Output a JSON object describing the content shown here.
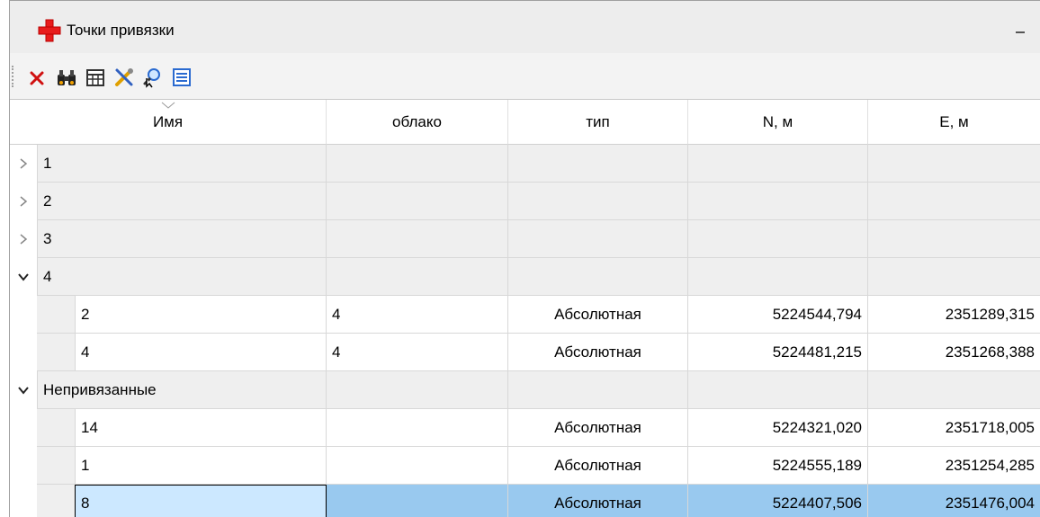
{
  "panel": {
    "title": "Точки привязки"
  },
  "toolbar": {
    "buttons": [
      {
        "name": "delete-icon"
      },
      {
        "name": "binoculars-icon"
      },
      {
        "name": "table-icon"
      },
      {
        "name": "tools-icon"
      },
      {
        "name": "zoom-to-icon"
      },
      {
        "name": "list-icon"
      }
    ]
  },
  "table": {
    "columns": [
      "Имя",
      "облако",
      "тип",
      "N, м",
      "E, м"
    ],
    "groups": [
      {
        "label": "1",
        "expanded": false,
        "rows": []
      },
      {
        "label": "2",
        "expanded": false,
        "rows": []
      },
      {
        "label": "3",
        "expanded": false,
        "rows": []
      },
      {
        "label": "4",
        "expanded": true,
        "rows": [
          {
            "name": "2",
            "cloud": "4",
            "type": "Абсолютная",
            "n": "5224544,794",
            "e": "2351289,315"
          },
          {
            "name": "4",
            "cloud": "4",
            "type": "Абсолютная",
            "n": "5224481,215",
            "e": "2351268,388"
          }
        ]
      },
      {
        "label": "Непривязанные",
        "expanded": true,
        "rows": [
          {
            "name": "14",
            "cloud": "",
            "type": "Абсолютная",
            "n": "5224321,020",
            "e": "2351718,005"
          },
          {
            "name": "1",
            "cloud": "",
            "type": "Абсолютная",
            "n": "5224555,189",
            "e": "2351254,285"
          },
          {
            "name": "8",
            "cloud": "",
            "type": "Абсолютная",
            "n": "5224407,506",
            "e": "2351476,004",
            "selected": true
          }
        ]
      }
    ]
  },
  "colors": {
    "accent": "#e81c1c",
    "selection": "#99c9ef",
    "focused": "#cce8ff",
    "group_bg": "#efefef"
  }
}
